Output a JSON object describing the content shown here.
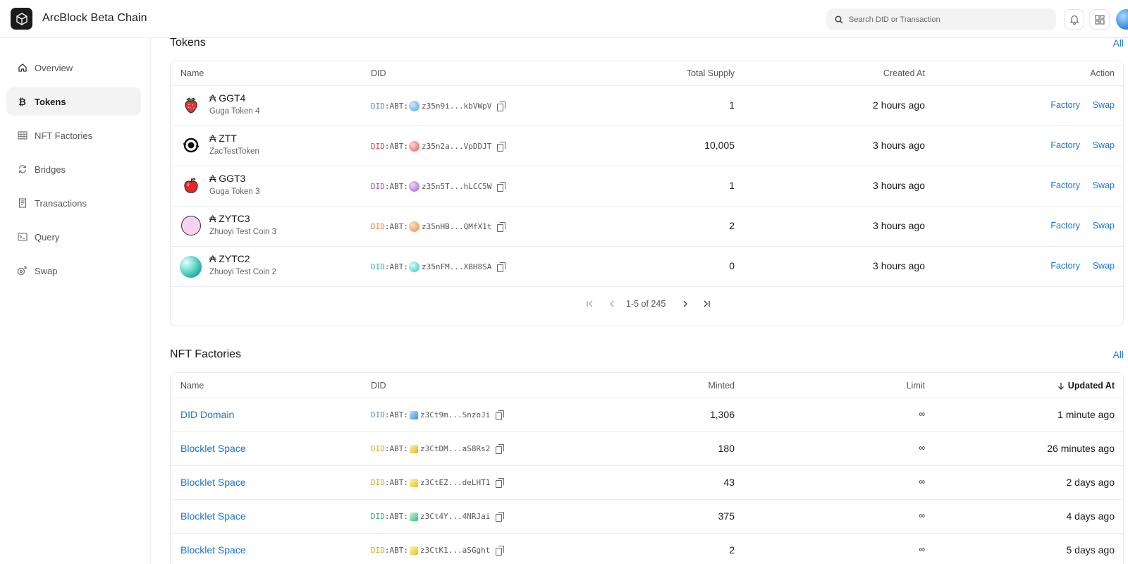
{
  "app": {
    "title": "ArcBlock Beta Chain"
  },
  "search": {
    "placeholder": "Search DID or Transaction"
  },
  "sidebar": {
    "items": [
      {
        "label": "Overview",
        "icon": "home-icon"
      },
      {
        "label": "Tokens",
        "icon": "bitcoin-icon"
      },
      {
        "label": "NFT Factories",
        "icon": "grid-icon"
      },
      {
        "label": "Bridges",
        "icon": "refresh-icon"
      },
      {
        "label": "Transactions",
        "icon": "receipt-icon"
      },
      {
        "label": "Query",
        "icon": "terminal-icon"
      },
      {
        "label": "Swap",
        "icon": "swap-coin-icon"
      }
    ],
    "active_index": 1
  },
  "tokens": {
    "title": "Tokens",
    "all_label": "All",
    "columns": [
      "Name",
      "DID",
      "Total Supply",
      "Created At",
      "Action"
    ],
    "rows": [
      {
        "symbol": "₳ GGT4",
        "name": "Guga Token 4",
        "did_prefix": "DID",
        "did_mid": ":ABT:",
        "did_value": "z35n9i...kbVWpV",
        "did_color": "#4a90c2",
        "icon_color": "#4aa3df",
        "supply": "1",
        "created": "2 hours ago",
        "logo": "strawberry"
      },
      {
        "symbol": "₳ ZTT",
        "name": "ZacTestToken",
        "did_prefix": "DID",
        "did_mid": ":ABT:",
        "did_value": "z35n2a...VpDDJT",
        "did_color": "#d64545",
        "icon_color": "#e05555",
        "supply": "10,005",
        "created": "3 hours ago",
        "logo": "eye"
      },
      {
        "symbol": "₳ GGT3",
        "name": "Guga Token 3",
        "did_prefix": "DID",
        "did_mid": ":ABT:",
        "did_value": "z35n5T...hLCC5W",
        "did_color": "#9b4fc4",
        "icon_color": "#a25bd1",
        "supply": "1",
        "created": "3 hours ago",
        "logo": "apple"
      },
      {
        "symbol": "₳ ZYTC3",
        "name": "Zhuoyi Test Coin 3",
        "did_prefix": "DID",
        "did_mid": ":ABT:",
        "did_value": "z35nHB...QMfX1t",
        "did_color": "#e0853b",
        "icon_color": "#e8893f",
        "supply": "2",
        "created": "3 hours ago",
        "logo": "pink"
      },
      {
        "symbol": "₳ ZYTC2",
        "name": "Zhuoyi Test Coin 2",
        "did_prefix": "DID",
        "did_mid": ":ABT:",
        "did_value": "z35nFM...XBH8SA",
        "did_color": "#2bb3a6",
        "icon_color": "#33c1b3",
        "supply": "0",
        "created": "3 hours ago",
        "logo": "teal"
      }
    ],
    "action_factory": "Factory",
    "action_swap": "Swap",
    "pagination": "1-5 of 245"
  },
  "nft_factories": {
    "title": "NFT Factories",
    "all_label": "All",
    "columns": [
      "Name",
      "DID",
      "Minted",
      "Limit",
      "Updated At"
    ],
    "rows": [
      {
        "name": "DID Domain",
        "did_prefix": "DID",
        "did_mid": ":ABT:",
        "did_value": "z3Ct9m...SnzoJi",
        "did_color": "#4a90c2",
        "icon_color": "#3d8ee0",
        "minted": "1,306",
        "limit": "∞",
        "updated": "1 minute ago"
      },
      {
        "name": "Blocklet Space",
        "did_prefix": "DID",
        "did_mid": ":ABT:",
        "did_value": "z3CtDM...aS8Rs2",
        "did_color": "#d9a521",
        "icon_color": "#e6b422",
        "minted": "180",
        "limit": "∞",
        "updated": "26 minutes ago"
      },
      {
        "name": "Blocklet Space",
        "did_prefix": "DID",
        "did_mid": ":ABT:",
        "did_value": "z3CtEZ...deLHT1",
        "did_color": "#d9a521",
        "icon_color": "#e6c222",
        "minted": "43",
        "limit": "∞",
        "updated": "2 days ago"
      },
      {
        "name": "Blocklet Space",
        "did_prefix": "DID",
        "did_mid": ":ABT:",
        "did_value": "z3Ct4Y...4NRJai",
        "did_color": "#2faa6a",
        "icon_color": "#3bbf78",
        "minted": "375",
        "limit": "∞",
        "updated": "4 days ago"
      },
      {
        "name": "Blocklet Space",
        "did_prefix": "DID",
        "did_mid": ":ABT:",
        "did_value": "z3CtK1...aSGght",
        "did_color": "#d9a521",
        "icon_color": "#e6c222",
        "minted": "2",
        "limit": "∞",
        "updated": "5 days ago"
      }
    ]
  }
}
